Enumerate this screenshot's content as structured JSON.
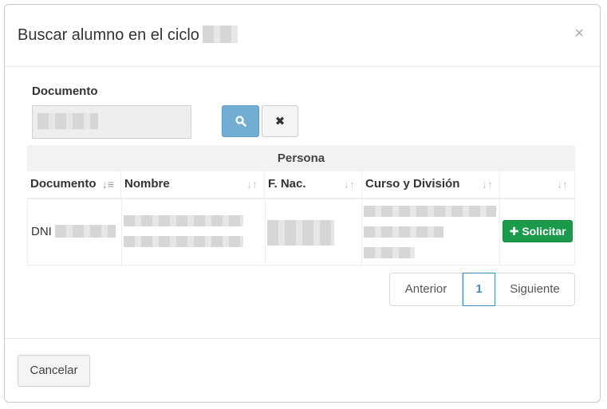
{
  "dialog": {
    "title": "Buscar alumno en el ciclo",
    "close_symbol": "×"
  },
  "search": {
    "label": "Documento",
    "search_icon": "search-icon",
    "clear_icon": "close-icon",
    "clear_symbol": "✖"
  },
  "table": {
    "group_header": "Persona",
    "columns": [
      "Documento",
      "Nombre",
      "F. Nac.",
      "Curso y División",
      ""
    ],
    "rows": [
      {
        "documento": "DNI",
        "action_label": "✚ Solicitar"
      }
    ]
  },
  "pagination": {
    "prev_label": "Anterior",
    "current_page": "1",
    "next_label": "Siguiente"
  },
  "footer": {
    "cancel_label": "Cancelar"
  },
  "colors": {
    "search_button": "#74add3",
    "solicitar_button": "#1a9a4a",
    "active_page": "#3c8dbc"
  }
}
